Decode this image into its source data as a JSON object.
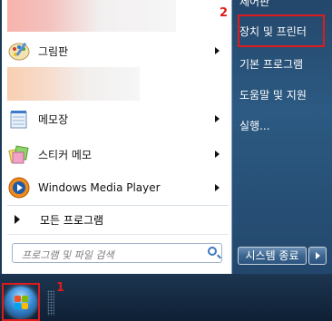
{
  "left_menu": {
    "programs": [
      {
        "label": "그림판",
        "icon": "paint-icon",
        "has_arrow": true
      },
      {
        "label": "메모장",
        "icon": "notepad-icon",
        "has_arrow": true
      },
      {
        "label": "스티커 메모",
        "icon": "sticky-notes-icon",
        "has_arrow": true
      },
      {
        "label": "Windows Media Player",
        "icon": "media-player-icon",
        "has_arrow": true
      }
    ],
    "all_programs_label": "모든 프로그램",
    "search_placeholder": "프로그램 및 파일 검색"
  },
  "right_menu": {
    "items": [
      {
        "label": "제어판"
      },
      {
        "label": "장치 및 프린터"
      },
      {
        "label": "기본 프로그램"
      },
      {
        "label": "도움말 및 지원"
      },
      {
        "label": "실행..."
      }
    ],
    "shutdown_label": "시스템 종료"
  },
  "annotations": {
    "step1": "1",
    "step2": "2",
    "color": "#e01b1b"
  },
  "taskbar": {
    "start_icon": "windows-orb-icon"
  }
}
